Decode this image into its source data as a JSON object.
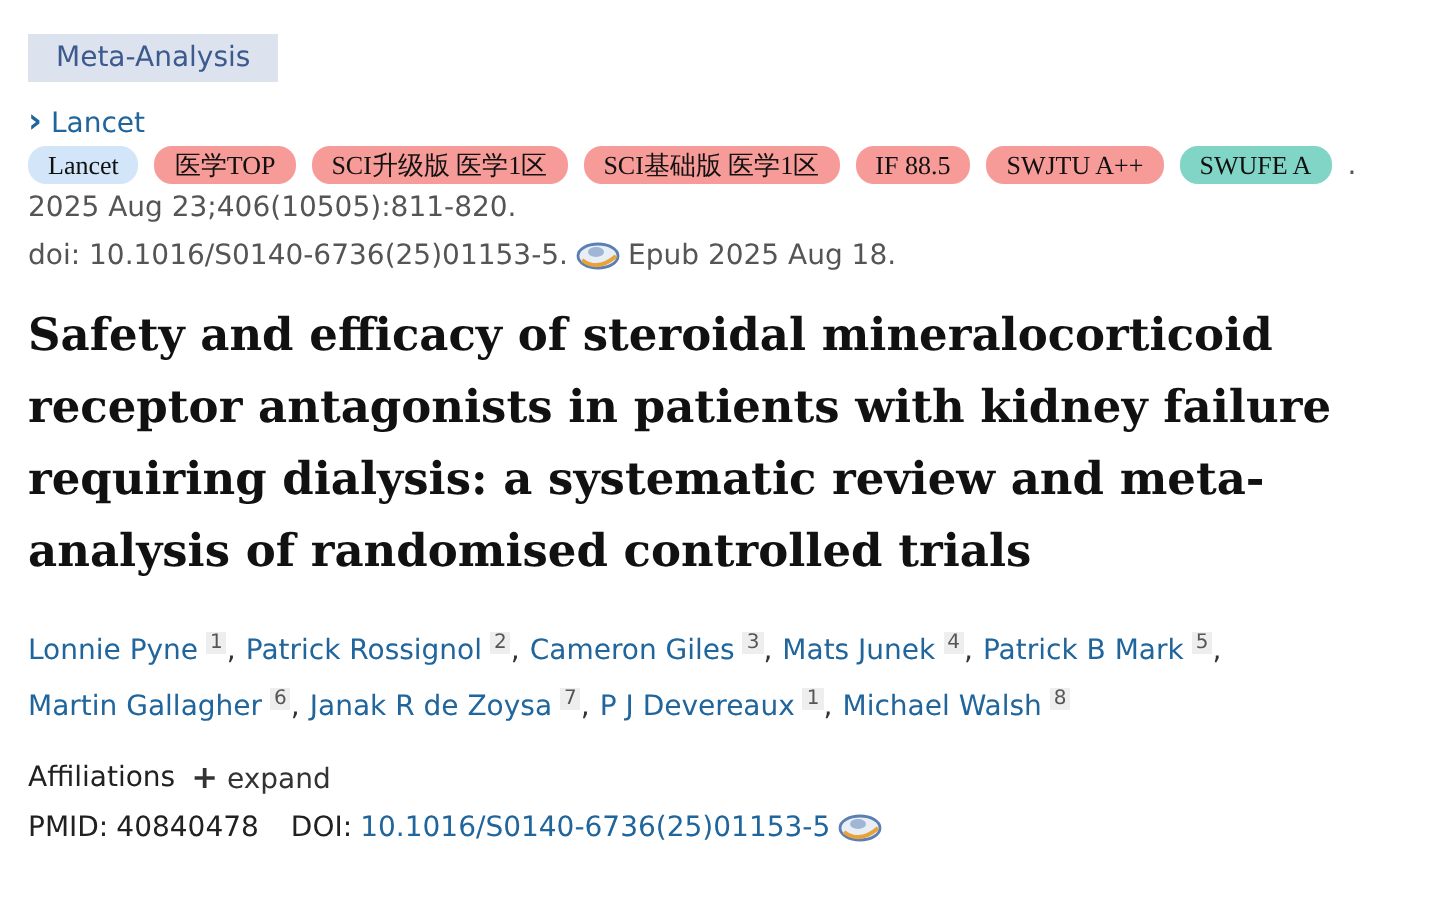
{
  "publication_type": "Meta-Analysis",
  "journal_link": {
    "arrow": "›",
    "label": "Lancet"
  },
  "tags": [
    {
      "label": "Lancet",
      "color": "#d3e5f8"
    },
    {
      "label": "医学TOP",
      "color": "#f79b98"
    },
    {
      "label": "SCI升级版 医学1区",
      "color": "#f79b98"
    },
    {
      "label": "SCI基础版 医学1区",
      "color": "#f79b98"
    },
    {
      "label": "IF 88.5",
      "color": "#f79b98"
    },
    {
      "label": "SWJTU A++",
      "color": "#f79b98"
    },
    {
      "label": "SWUFE A",
      "color": "#80d5c6"
    }
  ],
  "tags_trailing": ".",
  "citation": "2025 Aug 23;406(10505):811-820.",
  "doi_line": {
    "doi": "doi: 10.1016/S0140-6736(25)01153-5.",
    "epub": "Epub 2025 Aug 18."
  },
  "title": "Safety and efficacy of steroidal mineralocorticoid receptor antagonists in patients with kidney failure requiring dialysis: a systematic review and meta-analysis of randomised controlled trials",
  "authors": [
    {
      "name": "Lonnie Pyne",
      "affiliation": "1"
    },
    {
      "name": "Patrick Rossignol",
      "affiliation": "2"
    },
    {
      "name": "Cameron Giles",
      "affiliation": "3"
    },
    {
      "name": "Mats Junek",
      "affiliation": "4"
    },
    {
      "name": "Patrick B Mark",
      "affiliation": "5"
    },
    {
      "name": "Martin Gallagher",
      "affiliation": "6"
    },
    {
      "name": "Janak R de Zoysa",
      "affiliation": "7"
    },
    {
      "name": "P J Devereaux",
      "affiliation": "1"
    },
    {
      "name": "Michael Walsh",
      "affiliation": "8"
    }
  ],
  "author_separator": ",",
  "affiliations": {
    "label": "Affiliations",
    "toggle_icon": "+",
    "toggle": "expand"
  },
  "identifiers": {
    "pmid_label": "PMID:",
    "pmid": "40840478",
    "doi_label": "DOI:",
    "doi": "10.1016/S0140-6736(25)01153-5"
  }
}
